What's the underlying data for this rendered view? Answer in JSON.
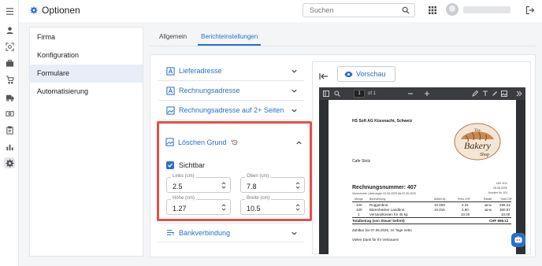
{
  "page_title": "Optionen",
  "search": {
    "placeholder": "Suchen"
  },
  "left_nav": {
    "items": [
      "Firma",
      "Konfiguration",
      "Formulare",
      "Automatisierung"
    ],
    "active": "Formulare"
  },
  "tabs": {
    "items": [
      "Allgemein",
      "Berichteinstellungen"
    ],
    "active": "Berichteinstellungen"
  },
  "sections": {
    "lieferadresse": "Lieferadresse",
    "rechnungsadresse": "Rechnungsadresse",
    "rechnungsadresse_2": "Rechnungsadresse auf 2+ Seiten",
    "loeschen_grund": "Löschen Grund",
    "bankverbindung": "Bankverbindung"
  },
  "loeschen_grund": {
    "sichtbar_label": "Sichtbar",
    "sichtbar_checked": true,
    "links_label": "Links (cm)",
    "links_value": "2.5",
    "oben_label": "Oben (cm)",
    "oben_value": "7.8",
    "hoehe_label": "Höhe (cm)",
    "hoehe_value": "1.27",
    "breite_label": "Breite (cm)",
    "breite_value": "10.5"
  },
  "preview": {
    "button_label": "Vorschau",
    "page_current": "1",
    "page_of": "of 1",
    "company_line": "HS Soft AG Küssnacht, Schweiz",
    "customer": "Cafe Stolz",
    "invoice_title": "Rechnungsnummer: 407",
    "invoice_dates_left": "Verrechnete Lieferungen 02.05.2025 bis 02.05.2025",
    "meta_right": [
      "UID 1111",
      "28.05.2025",
      "Kunden Nr. 101"
    ],
    "table_headers": [
      "Menge",
      "Bezeichnung",
      "Artikel-Nr.",
      "Preis CHF",
      "Rabatt",
      "Total CHF"
    ],
    "rows": [
      {
        "qty": "100",
        "desc": "Roggenbrot",
        "art": "10.009",
        "price": "3.31",
        "disc": "10 %",
        "total": "298.24"
      },
      {
        "qty": "100",
        "desc": "Bärenhäcker Landbrot",
        "art": "10.015",
        "price": "3.90",
        "disc": "10 %",
        "total": "350.87"
      },
      {
        "qty": "1",
        "desc": "Versandkosten für 45 kg",
        "art": "",
        "price": "10.00",
        "disc": "",
        "total": "10.00"
      }
    ],
    "total_label": "Totalbetrag (von Steuer befreit)",
    "total_value": "CHF 659.12",
    "payment_note": "Zahlbar bis 07.06.2025, 10 Tage netto",
    "thanks": "Vielen Dank für Ihr Vertrauen!",
    "logo_text_top": "The",
    "logo_text_main": "Bakery",
    "logo_text_bottom": "Shop"
  },
  "colors": {
    "accent": "#2c6fc7",
    "highlight_border": "#e0524a"
  },
  "icons": [
    "menu-icon",
    "user-icon",
    "scan-icon",
    "briefcase-icon",
    "cart-icon",
    "truck-icon",
    "money-icon",
    "clipboard-icon",
    "chart-icon",
    "gear-icon",
    "search-icon",
    "apps-grid-icon",
    "logout-icon"
  ]
}
